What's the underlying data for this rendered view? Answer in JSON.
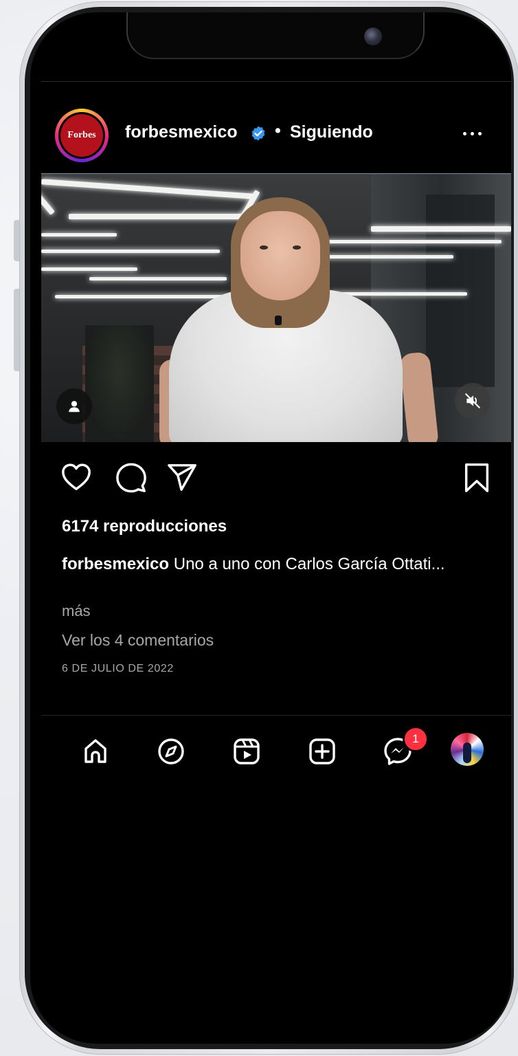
{
  "post": {
    "account_logo_text": "Forbes",
    "username": "forbesmexico",
    "separator": "•",
    "follow_status": "Siguiendo"
  },
  "video": {
    "muted": true
  },
  "engagement": {
    "views": "6174 reproducciones",
    "caption_user": "forbesmexico",
    "caption_text": " Uno a uno con Carlos García Ottati...",
    "more": "más",
    "comments_link": "Ver los 4 comentarios",
    "date": "6 DE JULIO DE 2022"
  },
  "tabbar": {
    "tabs": [
      "home-icon",
      "explore-icon",
      "reels-icon",
      "create-icon",
      "messenger-icon",
      "profile-avatar"
    ],
    "messages_badge": "1"
  },
  "colors": {
    "background": "#000000",
    "text": "#ffffff",
    "muted_text": "#a8a8a8",
    "verified": "#3897f0",
    "badge": "#ff3040"
  }
}
